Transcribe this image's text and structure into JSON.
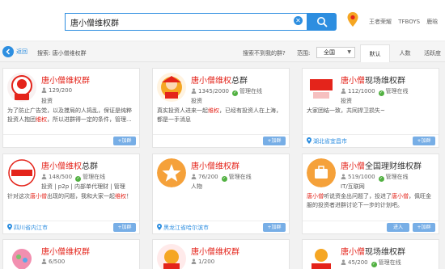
{
  "topbar": {
    "search_value": "唐小僧维权群",
    "hot_words": [
      "王者荣耀",
      "TFBOYS",
      "鹿晗"
    ]
  },
  "filterbar": {
    "back_label": "返回",
    "search_label": "搜索: 唐小僧维权群",
    "not_found": "搜索不到我的群?",
    "range_label": "范围:",
    "range_value": "全国",
    "sort_tabs": [
      "默认",
      "人数",
      "活跃度"
    ]
  },
  "cards": [
    {
      "name_hl": "唐小僧维权群",
      "name_rest": "",
      "members": "129/200",
      "managed": "",
      "tags": "投资",
      "desc": [
        {
          "t": "为了防止广告党，以及搅局的人捣乱，保证是纯粹投资人抱团",
          "h": false
        },
        {
          "t": "维权",
          "h": true
        },
        {
          "t": "，所以进群得一定的条件，管理...",
          "h": false
        }
      ],
      "location": "",
      "enter": "",
      "add": "+加群"
    },
    {
      "name_hl": "唐小僧维权",
      "name_rest": "总群",
      "members": "1345/2000",
      "managed": "管理在线",
      "tags": "投资",
      "desc": [
        {
          "t": "真实投资人进来一起",
          "h": false
        },
        {
          "t": "维权",
          "h": true
        },
        {
          "t": "，已经有投资人在上海，都是一手消息",
          "h": false
        }
      ],
      "location": "",
      "enter": "",
      "add": "+加群"
    },
    {
      "name_hl": "唐小僧",
      "name_rest": "现场维权群",
      "members": "112/1000",
      "managed": "管理在线",
      "tags": "投资",
      "desc": [
        {
          "t": "大家团结一致，共同捍卫损失~",
          "h": false
        }
      ],
      "location": "湖北省宜昌市",
      "enter": "",
      "add": "+加群"
    },
    {
      "name_hl": "唐小僧维权",
      "name_rest": "总群",
      "members": "148/500",
      "managed": "管理在线",
      "tags": "投资 | p2p | 内部单代理财 | 管理",
      "desc": [
        {
          "t": "针对这次",
          "h": false
        },
        {
          "t": "唐小僧",
          "h": true
        },
        {
          "t": "出现的问题，我和大家一起",
          "h": false
        },
        {
          "t": "维权",
          "h": true
        },
        {
          "t": "！",
          "h": false
        }
      ],
      "location": "四川省内江市",
      "enter": "",
      "add": "+加群"
    },
    {
      "name_hl": "唐小僧维权群",
      "name_rest": "",
      "members": "76/200",
      "managed": "管理在线",
      "tags": "人物",
      "desc": [],
      "location": "黑龙江省哈尔滨市",
      "enter": "",
      "add": "+加群"
    },
    {
      "name_hl": "唐小僧",
      "name_rest": "全国理财维权群",
      "members": "519/1000",
      "managed": "管理在线",
      "tags": "IT/互联网",
      "desc": [
        {
          "t": "唐小僧",
          "h": true
        },
        {
          "t": "听说资金出问题了，投进了",
          "h": false
        },
        {
          "t": "唐小僧",
          "h": true
        },
        {
          "t": "，佩旺金服的投资者进群讨论下一步的计划吧。",
          "h": false
        }
      ],
      "location": "",
      "enter": "进入",
      "add": "+加群"
    },
    {
      "name_hl": "唐小僧维权群",
      "name_rest": "",
      "members": "6/500",
      "managed": "",
      "tags": "",
      "desc": [],
      "location": "",
      "enter": "",
      "add": ""
    },
    {
      "name_hl": "唐小僧维权群",
      "name_rest": "",
      "members": "1/200",
      "managed": "",
      "tags": "",
      "desc": [],
      "location": "",
      "enter": "",
      "add": ""
    },
    {
      "name_hl": "唐小僧",
      "name_rest": "现场维权群",
      "members": "45/200",
      "managed": "管理在线",
      "tags": "",
      "desc": [],
      "location": "",
      "enter": "",
      "add": ""
    }
  ]
}
